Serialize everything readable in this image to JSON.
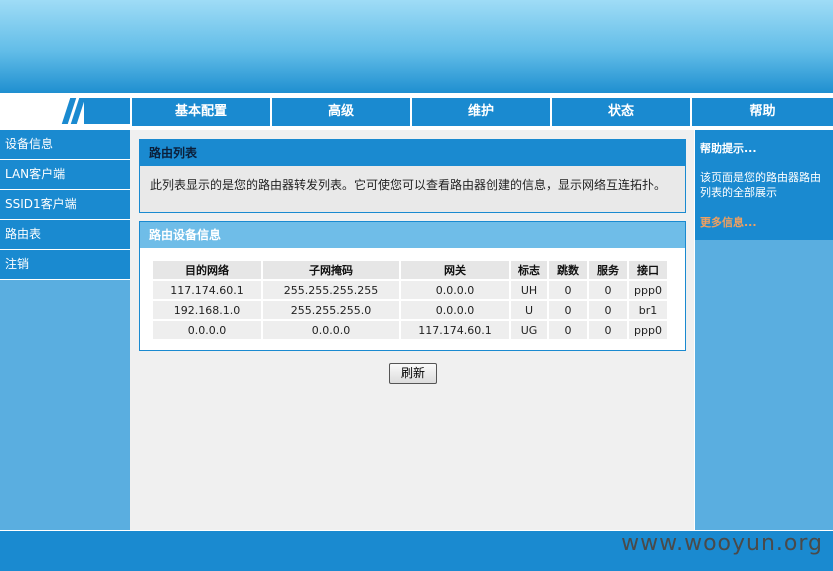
{
  "nav": {
    "tabs": [
      "基本配置",
      "高级",
      "维护",
      "状态",
      "帮助"
    ]
  },
  "sidebar": {
    "items": [
      "设备信息",
      "LAN客户端",
      "SSID1客户端",
      "路由表",
      "注销"
    ]
  },
  "route_list": {
    "title": "路由列表",
    "description": "此列表显示的是您的路由器转发列表。它可使您可以查看路由器创建的信息，显示网络互连拓扑。"
  },
  "route_info": {
    "title": "路由设备信息",
    "headers": [
      "目的网络",
      "子网掩码",
      "网关",
      "标志",
      "跳数",
      "服务",
      "接口"
    ],
    "rows": [
      [
        "117.174.60.1",
        "255.255.255.255",
        "0.0.0.0",
        "UH",
        "0",
        "0",
        "ppp0"
      ],
      [
        "192.168.1.0",
        "255.255.255.0",
        "0.0.0.0",
        "U",
        "0",
        "0",
        "br1"
      ],
      [
        "0.0.0.0",
        "0.0.0.0",
        "117.174.60.1",
        "UG",
        "0",
        "0",
        "ppp0"
      ]
    ]
  },
  "refresh_label": "刷新",
  "help": {
    "title": "帮助提示...",
    "text": "该页面是您的路由器路由列表的全部展示",
    "more": "更多信息..."
  },
  "watermark": "www.wooyun.org",
  "colors": {
    "primary_blue": "#1a8ad0",
    "light_blue": "#5aaee0",
    "more_link": "#f0a060"
  }
}
